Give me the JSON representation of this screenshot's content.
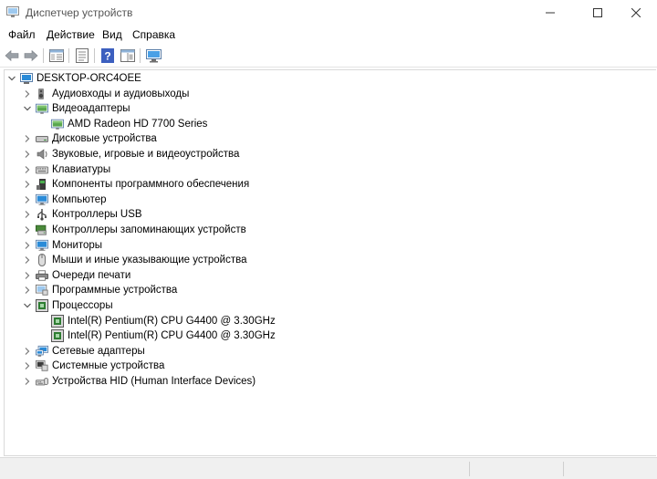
{
  "window": {
    "title": "Диспетчер устройств",
    "icon": "device-manager-icon",
    "controls": [
      "minimize-icon",
      "maximize-icon",
      "close-icon"
    ]
  },
  "menu": [
    {
      "label": "Файл"
    },
    {
      "label": "Действие"
    },
    {
      "label": "Вид"
    },
    {
      "label": "Справка"
    }
  ],
  "toolbar": {
    "buttons": [
      "back-arrow-icon",
      "forward-arrow-icon",
      "properties-pane-icon",
      "properties-icon",
      "help-icon",
      "view-pane-icon",
      "scan-hardware-icon"
    ]
  },
  "tree": {
    "root": {
      "label": "DESKTOP-ORC4OEE",
      "expanded": true,
      "icon": "computer-icon"
    },
    "nodes": [
      {
        "label": "Аудиовходы и аудиовыходы",
        "expanded": false,
        "icon": "speaker-icon"
      },
      {
        "label": "Видеоадаптеры",
        "expanded": true,
        "icon": "display-adapter-icon",
        "children": [
          {
            "label": "AMD Radeon HD 7700 Series",
            "icon": "display-adapter-icon"
          }
        ]
      },
      {
        "label": "Дисковые устройства",
        "expanded": false,
        "icon": "disk-drive-icon"
      },
      {
        "label": "Звуковые, игровые и видеоустройства",
        "expanded": false,
        "icon": "sound-device-icon"
      },
      {
        "label": "Клавиатуры",
        "expanded": false,
        "icon": "keyboard-icon"
      },
      {
        "label": "Компоненты программного обеспечения",
        "expanded": false,
        "icon": "software-component-icon"
      },
      {
        "label": "Компьютер",
        "expanded": false,
        "icon": "monitor-icon"
      },
      {
        "label": "Контроллеры USB",
        "expanded": false,
        "icon": "usb-icon"
      },
      {
        "label": "Контроллеры запоминающих устройств",
        "expanded": false,
        "icon": "storage-controller-icon"
      },
      {
        "label": "Мониторы",
        "expanded": false,
        "icon": "monitor-icon"
      },
      {
        "label": "Мыши и иные указывающие устройства",
        "expanded": false,
        "icon": "mouse-icon"
      },
      {
        "label": "Очереди печати",
        "expanded": false,
        "icon": "printer-icon"
      },
      {
        "label": "Программные устройства",
        "expanded": false,
        "icon": "software-device-icon"
      },
      {
        "label": "Процессоры",
        "expanded": true,
        "icon": "processor-icon",
        "children": [
          {
            "label": "Intel(R) Pentium(R) CPU G4400 @ 3.30GHz",
            "icon": "processor-icon"
          },
          {
            "label": "Intel(R) Pentium(R) CPU G4400 @ 3.30GHz",
            "icon": "processor-icon"
          }
        ]
      },
      {
        "label": "Сетевые адаптеры",
        "expanded": false,
        "icon": "network-adapter-icon"
      },
      {
        "label": "Системные устройства",
        "expanded": false,
        "icon": "system-device-icon"
      },
      {
        "label": "Устройства HID (Human Interface Devices)",
        "expanded": false,
        "icon": "hid-device-icon"
      }
    ]
  },
  "colors": {
    "monitor_blue": "#2a8bd8",
    "chip_green": "#2e7d32",
    "help_blue": "#3c5fbf"
  }
}
